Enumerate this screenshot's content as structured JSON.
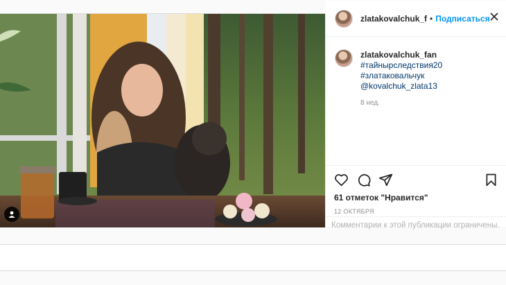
{
  "header": {
    "username": "zlatakovalchuk_f",
    "separator": "•",
    "follow_label": "Подписаться"
  },
  "caption": {
    "username": "zlatakovalchuk_fan",
    "tags_line1": "#тайнырследствия20 #златаковальчук",
    "mention": "@kovalchuk_zlata13",
    "age": "8 нед."
  },
  "actions": {
    "likes": "61 отметок \"Нравится\"",
    "date": "12 ОКТЯБРЯ"
  },
  "comments_disabled": "Комментарии к этой публикации ограничены.",
  "colors": {
    "link": "#00376b",
    "follow": "#0095f6",
    "muted": "#8e8e8e"
  },
  "icons": [
    "close-icon",
    "heart-icon",
    "comment-icon",
    "share-icon",
    "bookmark-icon",
    "user-tag-icon"
  ]
}
